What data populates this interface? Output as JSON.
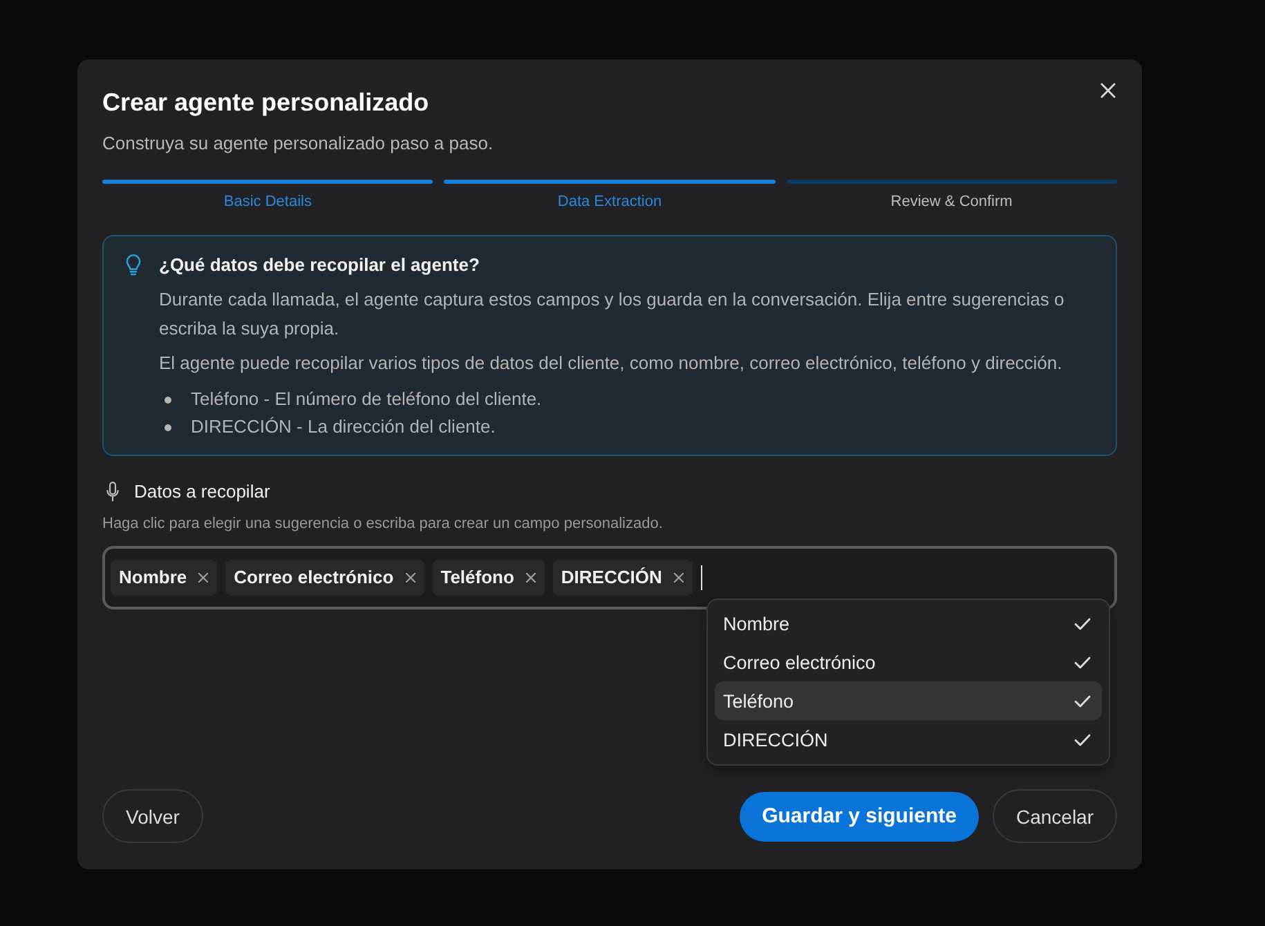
{
  "dialog": {
    "title": "Crear agente personalizado",
    "subtitle": "Construya su agente personalizado paso a paso."
  },
  "steps": [
    {
      "label": "Basic Details",
      "active": true
    },
    {
      "label": "Data Extraction",
      "active": true
    },
    {
      "label": "Review & Confirm",
      "active": false
    }
  ],
  "info_box": {
    "heading": "¿Qué datos debe recopilar el agente?",
    "paragraphs": [
      "Durante cada llamada, el agente captura estos campos y los guarda en la conversación. Elija entre sugerencias o escriba la suya propia.",
      "El agente puede recopilar varios tipos de datos del cliente, como nombre, correo electrónico, teléfono y dirección."
    ],
    "bullets": [
      "Teléfono - El número de teléfono del cliente.",
      "DIRECCIÓN - La dirección del cliente."
    ]
  },
  "field": {
    "label": "Datos a recopilar",
    "hint": "Haga clic para elegir una sugerencia o escriba para crear un campo personalizado.",
    "chips": [
      {
        "label": "Nombre"
      },
      {
        "label": "Correo electrónico"
      },
      {
        "label": "Teléfono"
      },
      {
        "label": "DIRECCIÓN"
      }
    ]
  },
  "dropdown": {
    "options": [
      {
        "label": "Nombre",
        "checked": true,
        "highlighted": false
      },
      {
        "label": "Correo electrónico",
        "checked": true,
        "highlighted": false
      },
      {
        "label": "Teléfono",
        "checked": true,
        "highlighted": true
      },
      {
        "label": "DIRECCIÓN",
        "checked": true,
        "highlighted": false
      }
    ]
  },
  "buttons": [
    {
      "label": "Volver",
      "kind": "secondary"
    },
    {
      "label": "Guardar y siguiente",
      "kind": "primary"
    },
    {
      "label": "Cancelar",
      "kind": "secondary"
    }
  ]
}
